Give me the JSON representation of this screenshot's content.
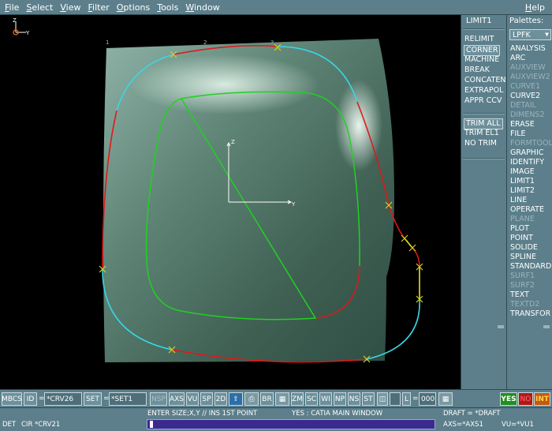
{
  "menubar": {
    "items": [
      "File",
      "Select",
      "View",
      "Filter",
      "Options",
      "Tools",
      "Window"
    ],
    "help": "Help"
  },
  "viewport": {
    "axis_small_z": "Z",
    "axis_small_y": "Y",
    "axis_center_z": "Z",
    "axis_center_y": "Y",
    "ruler": [
      "1",
      "2",
      "3",
      "4",
      "5"
    ]
  },
  "command_panel": {
    "title": "LIMIT1",
    "items": [
      "RELIMIT",
      "CORNER",
      "MACHINE",
      "BREAK",
      "CONCATEN",
      "EXTRAPOL",
      "APPR CCV"
    ],
    "items2": [
      "TRIM ALL",
      "TRIM EL1",
      "NO TRIM"
    ]
  },
  "palettes": {
    "title": "Palettes:",
    "selected": "LPFK",
    "items": [
      "ANALYSIS",
      "ARC",
      "AUXVIEW",
      "AUXVIEW2",
      "CURVE1",
      "CURVE2",
      "DETAIL",
      "DIMENS2",
      "ERASE",
      "FILE",
      "FORMTOOL",
      "GRAPHIC",
      "IDENTIFY",
      "IMAGE",
      "LIMIT1",
      "LIMIT2",
      "LINE",
      "OPERATE",
      "PLANE",
      "PLOT",
      "POINT",
      "SOLIDE",
      "SPLINE",
      "STANDARD",
      "SURF1",
      "SURF2",
      "TEXT",
      "TEXTD2",
      "TRANSFOR"
    ]
  },
  "toolbar": {
    "mbcs": "MBCS",
    "id_label": "ID",
    "id_value": "*CRV26",
    "set_label": "SET",
    "set_value": "*SET1",
    "buttons": [
      "NSP",
      "AXS",
      "VU",
      "SP",
      "2D",
      "BR",
      "ZM",
      "SC",
      "WI",
      "NP",
      "NS",
      "ST"
    ],
    "l_label": "L",
    "l_value": "000",
    "yes": "YES",
    "no": "NO",
    "int": "INT"
  },
  "status": {
    "prompt": "ENTER SIZE;X,Y // INS 1ST POINT",
    "yes_msg": "YES : CATIA MAIN WINDOW",
    "draft": "DRAFT = *DRAFT",
    "det": "DET",
    "cir": "CIR *CRV21",
    "axs": "AXS=*AXS1",
    "vu": "VU=*VU1"
  },
  "colors": {
    "panel": "#5c7f8b",
    "viewport": "#000000",
    "curve_red": "#e01818",
    "curve_cyan": "#38d8e8",
    "curve_green": "#22d022",
    "curve_yellow": "#e8e020",
    "marker": "#d8d020"
  }
}
